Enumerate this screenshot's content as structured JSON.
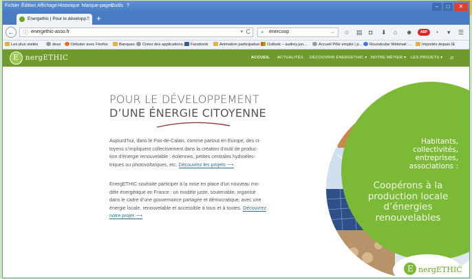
{
  "menubar": {
    "items": [
      "Fichier",
      "Édition",
      "Affichage",
      "Historique",
      "Marque-pages",
      "Outils",
      "?"
    ]
  },
  "tab": {
    "title": "Energethic | Pour le développ...",
    "close": "×",
    "new_tab": "+"
  },
  "navbar": {
    "back": "←",
    "url": "energethic-asso.fr",
    "search_value": "enercoop",
    "search_go": "→",
    "reload": "C"
  },
  "bookmarks": [
    "Les plus visités",
    "deez",
    "Débuter avec Firefox",
    "Banques",
    "Créez des applications...",
    "Facebook",
    "Animation participative",
    "Outlook – audrey.jun...",
    "Accueil Pôle emploi | p...",
    "Roundcube Webmail :...",
    "Importés depuis IE"
  ],
  "site": {
    "logo_text": "nergETHIC",
    "logo_letter": "E",
    "nav": [
      "ACCUEIL",
      "ACTUALITÉS",
      "DÉCOUVRIR ENERGETHIC ▾",
      "NOTRE MÉTIER ▾",
      "LES PROJETS ▾"
    ]
  },
  "content": {
    "headline_line1": "POUR LE DÉVELOPPEMENT",
    "headline_line2": "D’UNE ÉNERGIE CITOYENNE",
    "para1_lines": [
      "Aujourd’hui, dans le Pas-de-Calais, comme partout en Europe, des ci-",
      "toyens s’impliquent collectivement dans la création d’outil de produc-",
      "tion d’énergie renouvelable : éoliennes, petites centrales hydroélec-"
    ],
    "para1_last": "triques ou photovoltaïques, etc.",
    "para1_link": "Découvrez les projets ⟶",
    "para2_lines": [
      "EnergETHIC souhaite participer à la mise en place d’un nouveau mo-",
      "dèle énergétique en France : un modèle juste, soutenable, organisé",
      "dans le cadre d’une gouvernance partagée et démocratique, avec une"
    ],
    "para2_last": "énergie locale, renouvelable et accessible à tous et à toutes.",
    "para2_link": "Découvrez notre projet ⟶",
    "circle_small": [
      "Habitants,",
      "collectivités,",
      "entreprises,",
      "associations :"
    ],
    "circle_big": [
      "Coopérons à la",
      "production locale",
      "d’énergies",
      "renouvelables"
    ],
    "badge_text": "nergETHIC",
    "badge_letter": "E"
  },
  "colors": {
    "site_green": "#6f9b2d",
    "circle_green": "#7cb937",
    "link": "#2e6e8e"
  }
}
